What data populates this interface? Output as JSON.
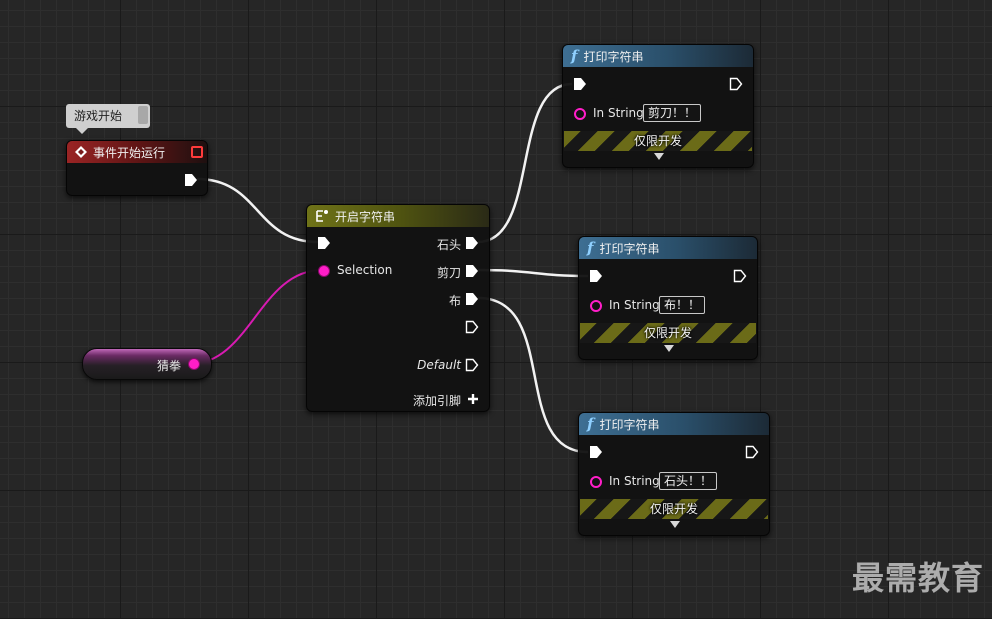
{
  "comment": {
    "text": "游戏开始"
  },
  "event_node": {
    "title": "事件开始运行"
  },
  "switch_node": {
    "title": "开启字符串",
    "selection_label": "Selection",
    "outputs": [
      "石头",
      "剪刀",
      "布"
    ],
    "default_label": "Default",
    "add_pin_label": "添加引脚"
  },
  "variable_node": {
    "label": "猜拳"
  },
  "print_nodes": [
    {
      "title": "打印字符串",
      "param_label": "In String",
      "value": "剪刀！！",
      "dev_label": "仅限开发"
    },
    {
      "title": "打印字符串",
      "param_label": "In String",
      "value": "布！！",
      "dev_label": "仅限开发"
    },
    {
      "title": "打印字符串",
      "param_label": "In String",
      "value": "石头！！",
      "dev_label": "仅限开发"
    }
  ],
  "watermark": "最需教育",
  "colors": {
    "background": "#262626",
    "exec_pin": "#ffffff",
    "string_pin": "#ff1ec8",
    "event_header": "#9a2424",
    "switch_header": "#6f7318",
    "function_header": "#3e6f93"
  }
}
